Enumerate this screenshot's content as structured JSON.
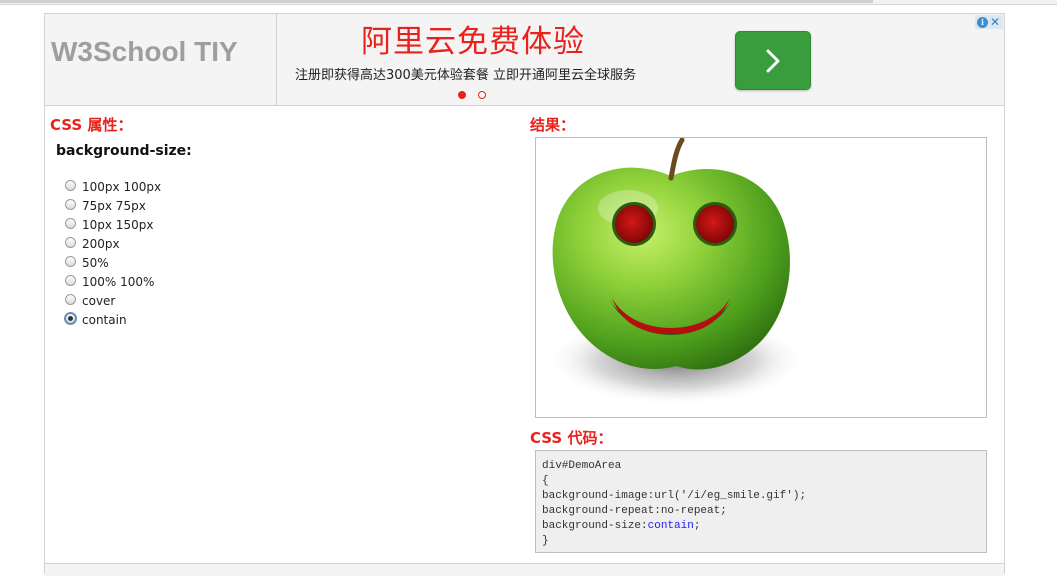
{
  "header": {
    "logo": "W3School TIY",
    "ad_title": "阿里云免费体验",
    "ad_subtitle": "注册即获得高达300美元体验套餐 立即开通阿里云全球服务",
    "ad_button_icon": "chevron-right-icon",
    "adchoices_info": "i",
    "adchoices_close": "✕"
  },
  "left": {
    "section_title": "CSS 属性：",
    "property_name": "background-size:",
    "options": [
      "100px 100px",
      "75px 75px",
      "10px 150px",
      "200px",
      "50%",
      "100% 100%",
      "cover",
      "contain"
    ],
    "selected": "contain"
  },
  "right": {
    "result_title": "结果：",
    "code_title": "CSS 代码：",
    "code": {
      "line1": "div#DemoArea",
      "line2": "{",
      "line3": "background-image:url('/i/eg_smile.gif');",
      "line4": "background-repeat:no-repeat;",
      "line5_prop": "background-size:",
      "line5_value": "contain",
      "line5_end": ";",
      "line6": "}"
    }
  },
  "colors": {
    "accent_red": "#e8221c",
    "button_green": "#3a9d3d",
    "code_value_blue": "#1a1aff"
  }
}
